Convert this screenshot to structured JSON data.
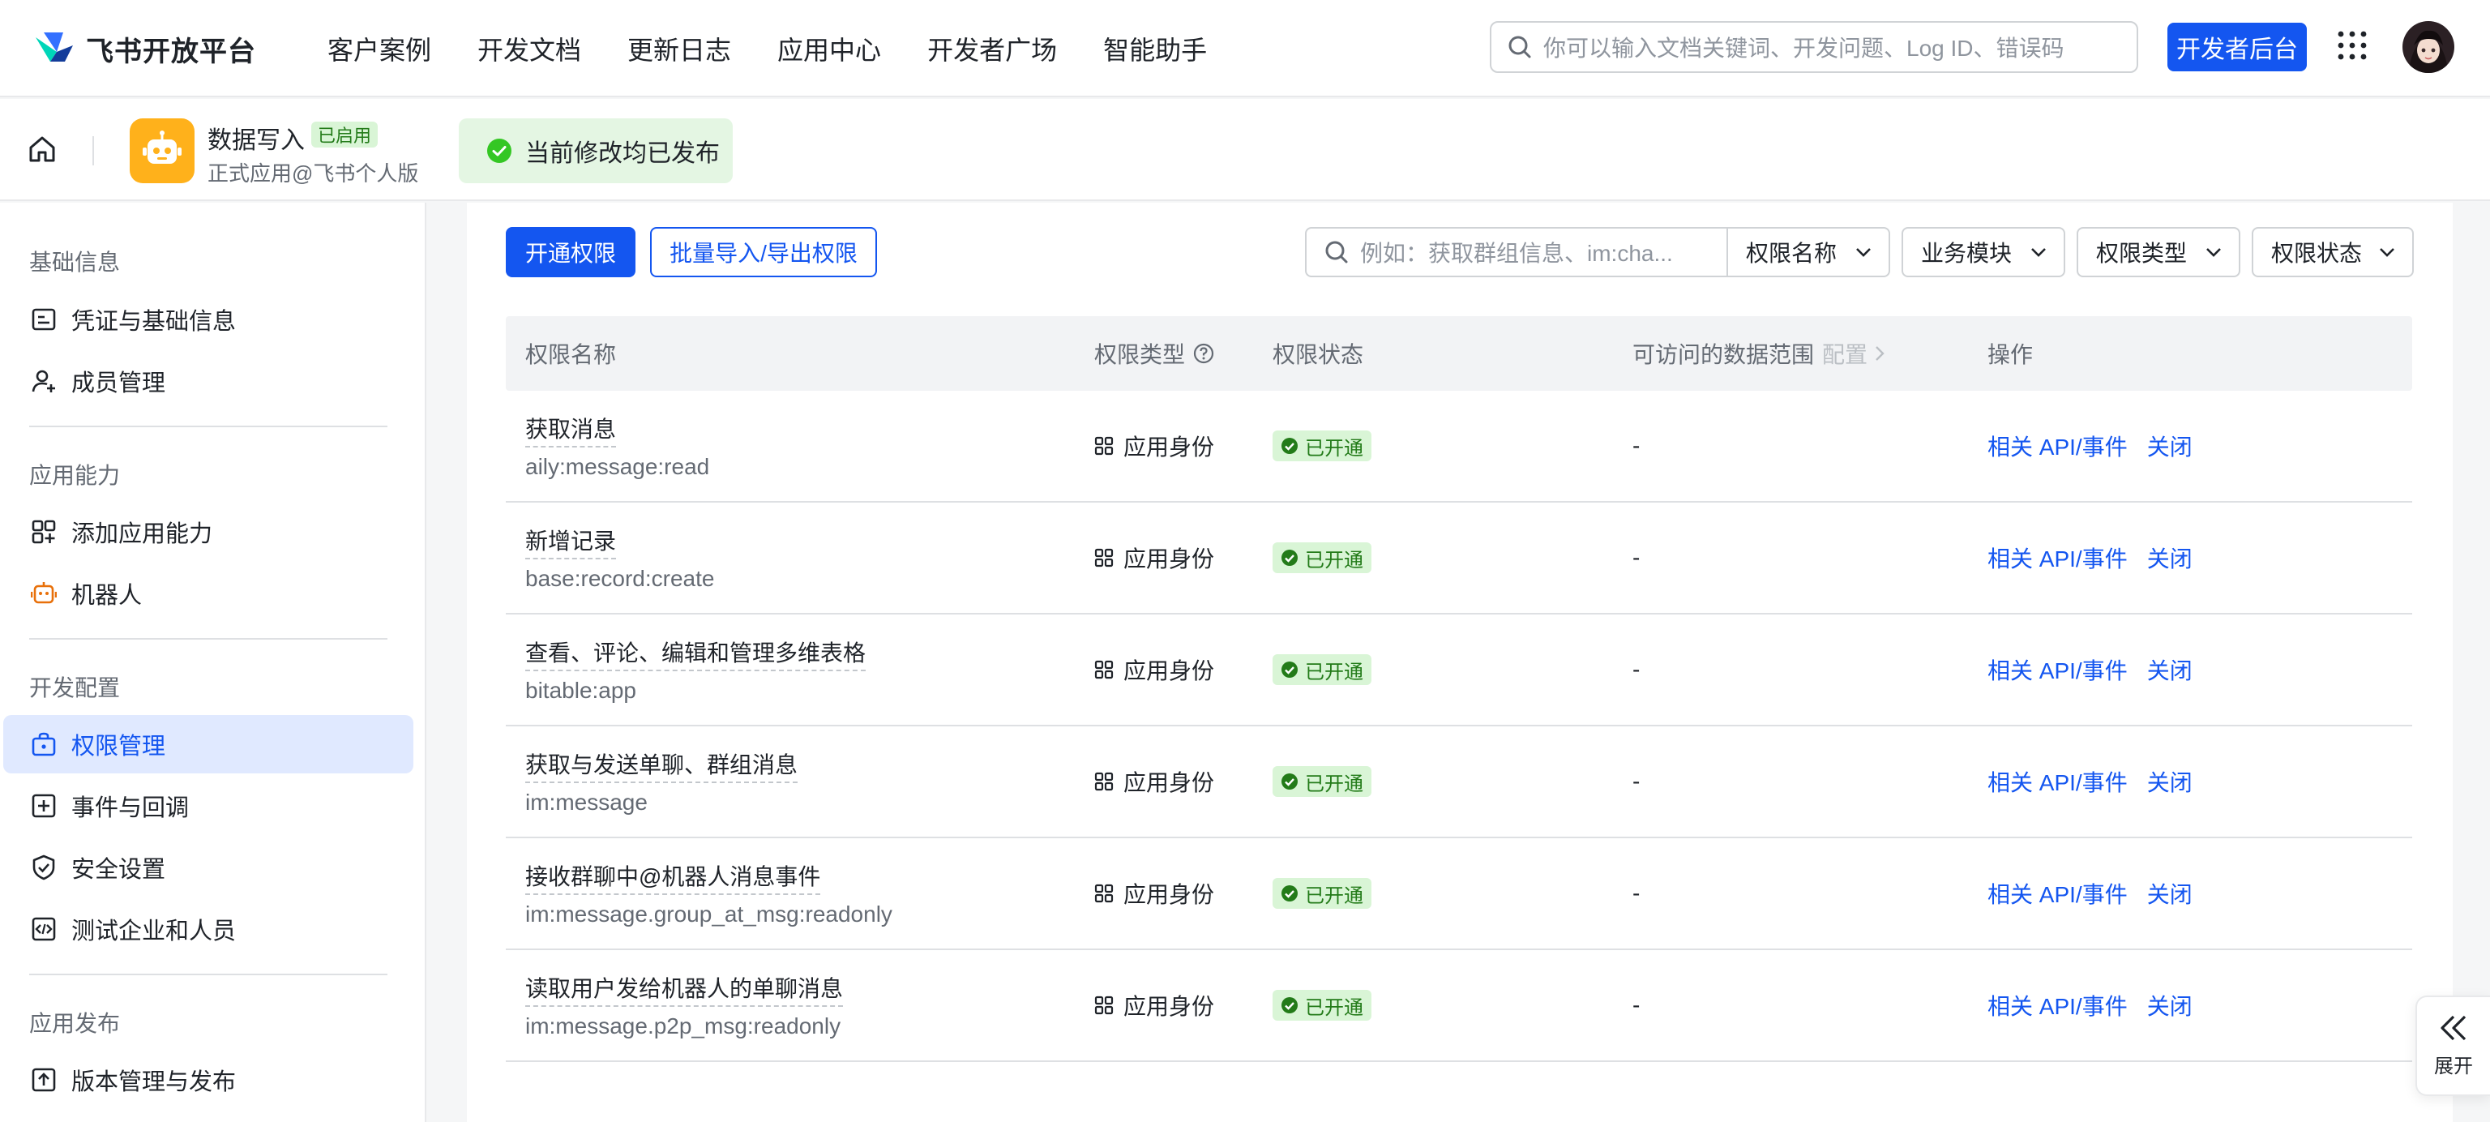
{
  "header": {
    "logo_text": "飞书开放平台",
    "nav": [
      "客户案例",
      "开发文档",
      "更新日志",
      "应用中心",
      "开发者广场",
      "智能助手"
    ],
    "search_placeholder": "你可以输入文档关键词、开发问题、Log ID、错误码",
    "console_button": "开发者后台",
    "brand_color": "#1456f0"
  },
  "app": {
    "name": "数据写入",
    "badge": "已启用",
    "subtitle": "正式应用@飞书个人版",
    "publish_status": "当前修改均已发布"
  },
  "sidebar": {
    "groups": [
      {
        "title": "基础信息",
        "items": [
          {
            "label": "凭证与基础信息",
            "icon": "credential-icon"
          },
          {
            "label": "成员管理",
            "icon": "add-member-icon"
          }
        ]
      },
      {
        "title": "应用能力",
        "items": [
          {
            "label": "添加应用能力",
            "icon": "add-capability-icon"
          },
          {
            "label": "机器人",
            "icon": "robot-icon"
          }
        ]
      },
      {
        "title": "开发配置",
        "items": [
          {
            "label": "权限管理",
            "icon": "permission-icon",
            "active": true
          },
          {
            "label": "事件与回调",
            "icon": "event-icon"
          },
          {
            "label": "安全设置",
            "icon": "shield-icon"
          },
          {
            "label": "测试企业和人员",
            "icon": "code-icon"
          }
        ]
      },
      {
        "title": "应用发布",
        "items": [
          {
            "label": "版本管理与发布",
            "icon": "upload-icon"
          }
        ]
      }
    ]
  },
  "toolbar": {
    "enable_button": "开通权限",
    "import_export_button": "批量导入/导出权限",
    "search_placeholder": "例如：获取群组信息、im:cha...",
    "filters": [
      "权限名称",
      "业务模块",
      "权限类型",
      "权限状态"
    ]
  },
  "table": {
    "columns": {
      "name": "权限名称",
      "type": "权限类型",
      "status": "权限状态",
      "scope": "可访问的数据范围",
      "scope_config": "配置",
      "ops": "操作"
    },
    "rows": [
      {
        "name": "获取消息",
        "code": "aily:message:read",
        "type": "应用身份",
        "status": "已开通",
        "scope": "-",
        "api": "相关 API/事件",
        "close": "关闭"
      },
      {
        "name": "新增记录",
        "code": "base:record:create",
        "type": "应用身份",
        "status": "已开通",
        "scope": "-",
        "api": "相关 API/事件",
        "close": "关闭"
      },
      {
        "name": "查看、评论、编辑和管理多维表格",
        "code": "bitable:app",
        "type": "应用身份",
        "status": "已开通",
        "scope": "-",
        "api": "相关 API/事件",
        "close": "关闭"
      },
      {
        "name": "获取与发送单聊、群组消息",
        "code": "im:message",
        "type": "应用身份",
        "status": "已开通",
        "scope": "-",
        "api": "相关 API/事件",
        "close": "关闭"
      },
      {
        "name": "接收群聊中@机器人消息事件",
        "code": "im:message.group_at_msg:readonly",
        "type": "应用身份",
        "status": "已开通",
        "scope": "-",
        "api": "相关 API/事件",
        "close": "关闭"
      },
      {
        "name": "读取用户发给机器人的单聊消息",
        "code": "im:message.p2p_msg:readonly",
        "type": "应用身份",
        "status": "已开通",
        "scope": "-",
        "api": "相关 API/事件",
        "close": "关闭"
      }
    ]
  },
  "float": {
    "expand_label": "展开"
  }
}
